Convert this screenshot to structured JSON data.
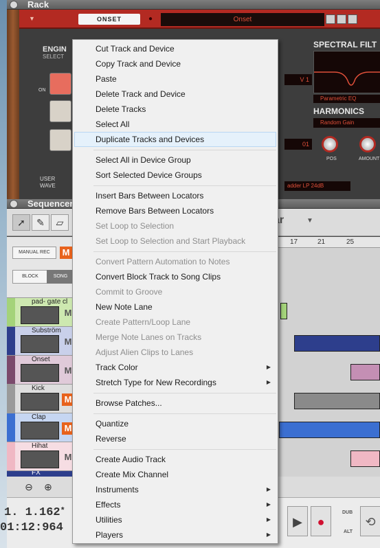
{
  "rack": {
    "title": "Rack",
    "patch_name": "ONSET",
    "patch_display": "Onset",
    "engine_label": "ENGIN",
    "engine_sub": "SELECT",
    "on_label": "ON",
    "userwave_line1": "USER",
    "userwave_line2": "WAVE",
    "disp_1": "V 1",
    "disp_2": "01",
    "spectral_title": "SPECTRAL FILT",
    "spectral_mode": "Parametric EQ",
    "harmonics_title": "HARMONICS",
    "harmonics_mode": "Random Gain",
    "knob_pos_label": "POS",
    "knob_amount_label": "AMOUNT",
    "filter_display": "adder LP 24dB",
    "accent_color": "#b32a22"
  },
  "sequencer": {
    "title": "Sequencer",
    "bar_label": "ar",
    "manual_rec_label": "MANUAL REC",
    "m_label": "M",
    "block_label": "BLOCK",
    "song_label": "SONG",
    "ruler_ticks": [
      "17",
      "21",
      "25"
    ],
    "tracks": [
      {
        "name": "pad- gate cl",
        "color": "#a4d37a"
      },
      {
        "name": "Subström",
        "color": "#2d3e8c"
      },
      {
        "name": "Onset",
        "color": "#7b4a6c"
      },
      {
        "name": "Kick",
        "color": "#9a9a9a"
      },
      {
        "name": "Clap",
        "color": "#3b6fd1"
      },
      {
        "name": "Hihat",
        "color": "#f0b8c4"
      }
    ],
    "fx_track_name": "FX",
    "zoom_out_icon": "zoom-out-icon",
    "zoom_in_icon": "zoom-in-icon"
  },
  "transport": {
    "position": "1.  1.162",
    "asterisk": "*",
    "time": "01:12:964",
    "dub_label": "DUB",
    "alt_label": "ALT"
  },
  "context_menu": {
    "items": [
      {
        "label": "Cut Track and Device",
        "enabled": true
      },
      {
        "label": "Copy Track and Device",
        "enabled": true
      },
      {
        "label": "Paste",
        "enabled": true
      },
      {
        "label": "Delete Track and Device",
        "enabled": true
      },
      {
        "label": "Delete Tracks",
        "enabled": true
      },
      {
        "label": "Select All",
        "enabled": true
      },
      {
        "label": "Duplicate Tracks and Devices",
        "enabled": true,
        "highlighted": true
      },
      {
        "label": "Select All in Device Group",
        "enabled": true
      },
      {
        "label": "Sort Selected Device Groups",
        "enabled": true
      },
      {
        "label": "Insert Bars Between Locators",
        "enabled": true
      },
      {
        "label": "Remove Bars Between Locators",
        "enabled": true
      },
      {
        "label": "Set Loop to Selection",
        "enabled": false
      },
      {
        "label": "Set Loop to Selection and Start Playback",
        "enabled": false
      },
      {
        "label": "Convert Pattern Automation to Notes",
        "enabled": false
      },
      {
        "label": "Convert Block Track to Song Clips",
        "enabled": true
      },
      {
        "label": "Commit to Groove",
        "enabled": false
      },
      {
        "label": "New Note Lane",
        "enabled": true
      },
      {
        "label": "Create Pattern/Loop Lane",
        "enabled": false
      },
      {
        "label": "Merge Note Lanes on Tracks",
        "enabled": false
      },
      {
        "label": "Adjust Alien Clips to Lanes",
        "enabled": false
      },
      {
        "label": "Track Color",
        "enabled": true,
        "submenu": true
      },
      {
        "label": "Stretch Type for New Recordings",
        "enabled": true,
        "submenu": true
      },
      {
        "label": "Browse Patches...",
        "enabled": true
      },
      {
        "label": "Quantize",
        "enabled": true
      },
      {
        "label": "Reverse",
        "enabled": true
      },
      {
        "label": "Create Audio Track",
        "enabled": true
      },
      {
        "label": "Create Mix Channel",
        "enabled": true
      },
      {
        "label": "Instruments",
        "enabled": true,
        "submenu": true
      },
      {
        "label": "Effects",
        "enabled": true,
        "submenu": true
      },
      {
        "label": "Utilities",
        "enabled": true,
        "submenu": true
      },
      {
        "label": "Players",
        "enabled": true,
        "submenu": true
      }
    ]
  }
}
